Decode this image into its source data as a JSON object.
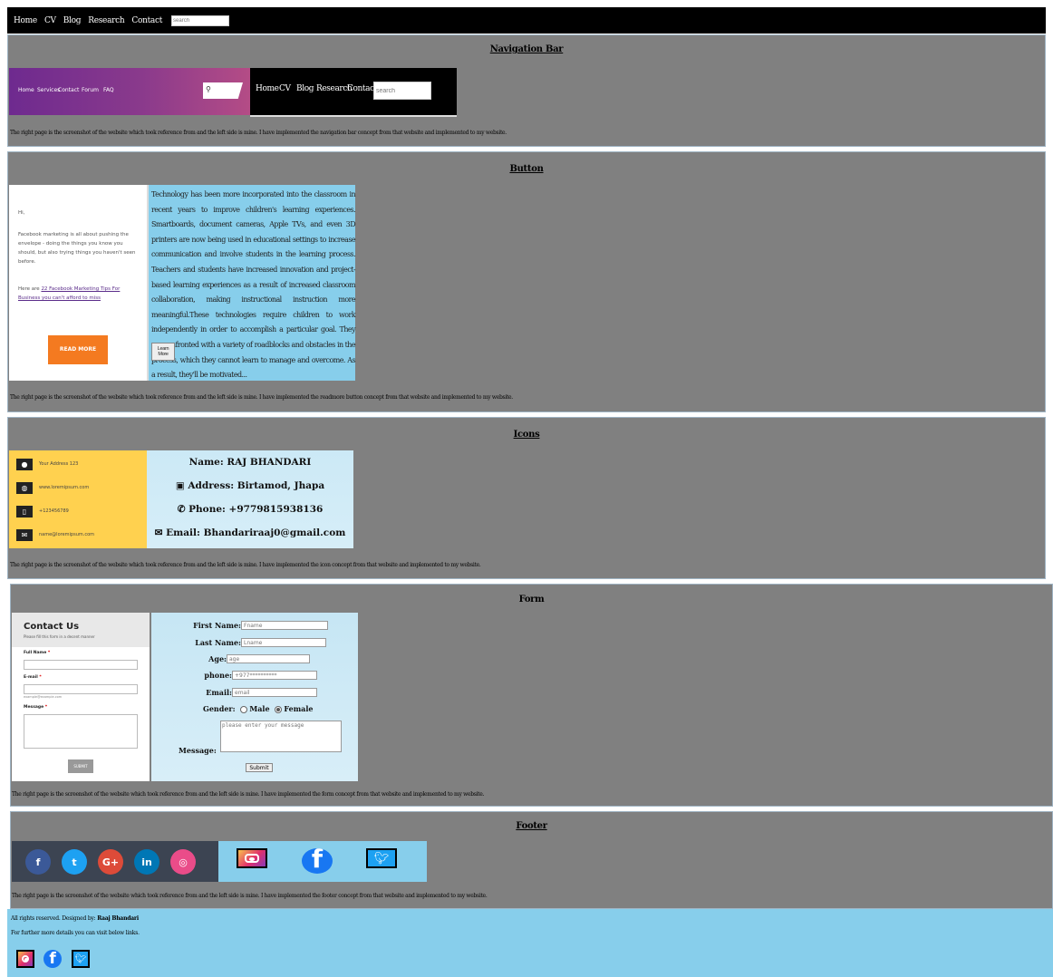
{
  "topnav": {
    "links": [
      "Home",
      "CV",
      "Blog",
      "Research",
      "Contact"
    ],
    "search_placeholder": "search"
  },
  "sections": {
    "navbar": {
      "title": "Navigation Bar",
      "reference_links": [
        "Home",
        "Services",
        "Contact",
        "Forum",
        "FAQ"
      ],
      "mine_links": [
        "Home",
        "CV",
        "Blog",
        "Research",
        "Contact"
      ],
      "mine_search_placeholder": "search",
      "caption": "The right page is the screenshot of the website which took reference from and the left side is mine. I have implemented the navigation bar concept from that website and implemented to my website."
    },
    "button": {
      "title": "Button",
      "ref_greeting": "Hi,",
      "ref_text": "Facebook marketing is all about pushing the envelope - doing the things you know you should, but also trying things you haven't seen before.",
      "ref_link_prefix": "Here are ",
      "ref_link": "22 Facebook Marketing Tips For Business you can't afford to miss",
      "ref_button": "READ MORE",
      "mine_text": "Technology has been more incorporated into the classroom in recent years to improve children's learning experiences. Smartboards, document cameras, Apple TVs, and even 3D printers are now being used in educational settings to increase communication and involve students in the learning process. Teachers and students have increased innovation and project-based learning experiences as a result of increased classroom collaboration, making instructional instruction more meaningful.These technologies require children to work independently in order to accomplish a particular goal. They are confronted with a variety of roadblocks and obstacles in the process, which they cannot learn to manage and overcome. As a result, they'll be motivated...",
      "mine_button": "Learn More",
      "caption": "The right page is the screenshot of the website which took reference from and the left side is mine. I have implemented the readmore button concept from that website and implemented to my website."
    },
    "icons": {
      "title": "Icons",
      "ref_rows": [
        {
          "icon": "location-icon",
          "text": "Your Address 123"
        },
        {
          "icon": "globe-icon",
          "text": "www.loremipsum.com"
        },
        {
          "icon": "phone-icon",
          "text": "+123456789"
        },
        {
          "icon": "mail-icon",
          "text": "name@loremipsum.com"
        }
      ],
      "mine_name": "Name: RAJ BHANDARI",
      "mine_address": "Address: Birtamod, Jhapa",
      "mine_phone": "Phone: +9779815938136",
      "mine_email": "Email: Bhandariraaj0@gmail.com",
      "caption": "The right page is the screenshot of the website which took reference from and the left side is mine. I have implemented the icon concept from that website and implemented to my website."
    },
    "form": {
      "title": "Form",
      "ref_title": "Contact Us",
      "ref_subtitle": "Please fill this form in a decent manner",
      "ref_fullname": "Full Name",
      "ref_email": "E-mail",
      "ref_email_hint": "example@example.com",
      "ref_message": "Message",
      "ref_submit": "SUBMIT",
      "required_mark": "*",
      "first_name_label": "First Name:",
      "first_name_placeholder": "Fname",
      "last_name_label": "Last Name:",
      "last_name_placeholder": "Lname",
      "age_label": "Age:",
      "age_placeholder": "age",
      "phone_label": "phone:",
      "phone_placeholder": "+977**********",
      "email_label": "Email:",
      "email_placeholder": "email",
      "gender_label": "Gender:",
      "gender_male": "Male",
      "gender_female": "Female",
      "gender_selected": "Female",
      "message_label": "Message:",
      "message_placeholder": "please enter your message",
      "submit_label": "Submit",
      "caption": "The right page is the screenshot of the website which took reference from and the left side is mine. I have implemented the form concept from that website and implemented to my website."
    },
    "footer": {
      "title": "Footer",
      "ref_social": [
        {
          "icon": "facebook-icon",
          "glyph": "f",
          "color": "#3b5998"
        },
        {
          "icon": "twitter-icon",
          "glyph": "t",
          "color": "#1da1f2"
        },
        {
          "icon": "google-plus-icon",
          "glyph": "G+",
          "color": "#dd4b39"
        },
        {
          "icon": "linkedin-icon",
          "glyph": "in",
          "color": "#0077b5"
        },
        {
          "icon": "dribbble-icon",
          "glyph": "◎",
          "color": "#ea4c89"
        }
      ],
      "caption": "The right page is the screenshot of the website which took reference from and the left side is mine. I have implemented the footer concept from that website and implemented to my website."
    }
  },
  "site_footer": {
    "rights_prefix": "All rights reserved. Designed by: ",
    "designer": "Raaj Bhandari",
    "details": "For further more details you can visit below links."
  },
  "colors": {
    "section_bg": "#808080",
    "sky": "#87ceeb",
    "readmore_orange": "#f47a20",
    "ref_icons_yellow": "#ffd14f"
  }
}
